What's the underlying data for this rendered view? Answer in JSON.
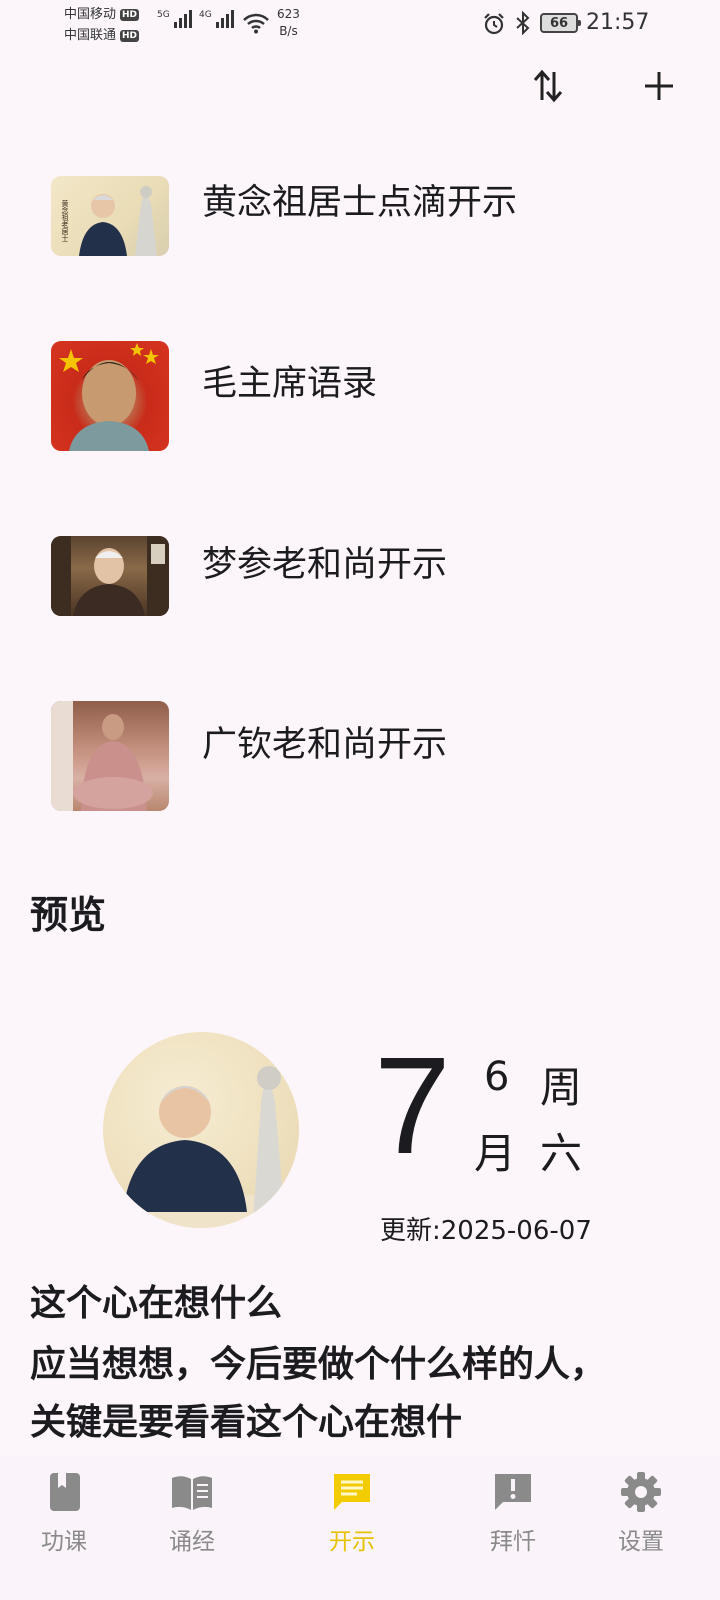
{
  "status_bar": {
    "carrier_1": "中国移动",
    "carrier_2": "中国联通",
    "hd_badge": "HD",
    "signal_1_label": "5G",
    "signal_2_label": "4G",
    "net_speed_value": "623",
    "net_speed_unit": "B/s",
    "battery": "66",
    "time": "21:57"
  },
  "toolbar": {
    "sort_icon": "swap-vertical-icon",
    "add_icon": "plus-icon"
  },
  "list": {
    "items": [
      {
        "title": "黄念祖居士点滴开示",
        "thumb_caption": "黄念祖老居士"
      },
      {
        "title": "毛主席语录"
      },
      {
        "title": "梦参老和尚开示"
      },
      {
        "title": "广钦老和尚开示"
      }
    ]
  },
  "preview": {
    "section_title": "预览",
    "day": "7",
    "month_num": "6",
    "month_label": "月",
    "weekday_label": "周",
    "weekday_value": "六",
    "updated": "更新:2025-06-07",
    "quote_title": "这个心在想什么",
    "quote_body": "应当想想，今后要做个什么样的人，关键是要看看这个心在想什"
  },
  "bottom_nav": {
    "items": [
      {
        "label": "功课",
        "icon": "bookmark-book-icon",
        "active": false
      },
      {
        "label": "诵经",
        "icon": "open-book-icon",
        "active": false
      },
      {
        "label": "开示",
        "icon": "message-icon",
        "active": true
      },
      {
        "label": "拜忏",
        "icon": "alert-message-icon",
        "active": false
      },
      {
        "label": "设置",
        "icon": "gear-icon",
        "active": false
      }
    ],
    "active_color": "#e6c200",
    "inactive_color": "#8a8a8a"
  }
}
